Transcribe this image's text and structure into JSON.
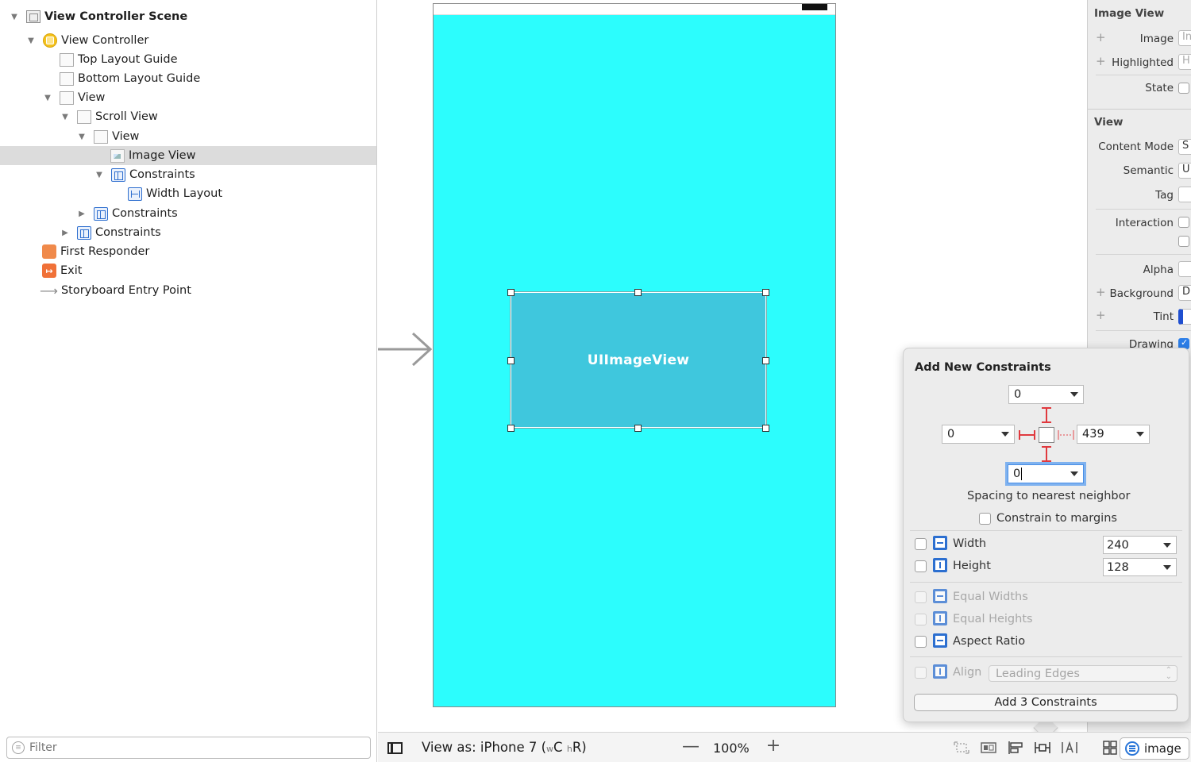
{
  "outline": {
    "items": [
      {
        "label": "View Controller Scene",
        "expanded": true,
        "icon": "scene-icon"
      },
      {
        "label": "View Controller",
        "expanded": true,
        "icon": "view-controller-icon"
      },
      {
        "label": "Top Layout Guide",
        "icon": "layout-guide-icon"
      },
      {
        "label": "Bottom Layout Guide",
        "icon": "layout-guide-icon"
      },
      {
        "label": "View",
        "expanded": true,
        "icon": "view-icon"
      },
      {
        "label": "Scroll View",
        "expanded": true,
        "icon": "scroll-view-icon"
      },
      {
        "label": "View",
        "expanded": true,
        "icon": "view-icon"
      },
      {
        "label": "Image View",
        "selected": true,
        "icon": "image-view-icon"
      },
      {
        "label": "Constraints",
        "expanded": true,
        "icon": "constraints-icon"
      },
      {
        "label": "Width Layout",
        "icon": "width-constraint-icon"
      },
      {
        "label": "Constraints",
        "expanded": false,
        "icon": "constraints-icon"
      },
      {
        "label": "Constraints",
        "expanded": false,
        "icon": "constraints-icon"
      },
      {
        "label": "First Responder",
        "icon": "first-responder-icon"
      },
      {
        "label": "Exit",
        "icon": "exit-icon"
      },
      {
        "label": "Storyboard Entry Point",
        "icon": "entry-arrow-icon"
      }
    ],
    "filter_placeholder": "Filter"
  },
  "canvas": {
    "image_view_label": "UIImageView",
    "phone_background": "#2cfdfd",
    "image_view_color": "#3fc7dd"
  },
  "bottombar": {
    "view_as": "View as: iPhone 7 (",
    "size_class_w": "w",
    "size_class_c": "C",
    "size_class_h": "h",
    "size_class_r": "R",
    "zoom_out": "—",
    "zoom_level": "100%",
    "zoom_in": "+",
    "image_pill": "image"
  },
  "inspector": {
    "image_view_title": "Image View",
    "image_label": "Image",
    "image_value": "In",
    "highlighted_label": "Highlighted",
    "highlighted_value": "H",
    "state_label": "State",
    "view_title": "View",
    "content_mode_label": "Content Mode",
    "content_mode_value": "S",
    "semantic_label": "Semantic",
    "semantic_value": "U",
    "tag_label": "Tag",
    "interaction_label": "Interaction",
    "alpha_label": "Alpha",
    "background_label": "Background",
    "background_value": "D",
    "tint_label": "Tint",
    "drawing_label": "Drawing",
    "plus": "+"
  },
  "constraints_popover": {
    "title": "Add New Constraints",
    "top_value": "0",
    "leading_value": "0",
    "trailing_value": "439",
    "bottom_value": "0",
    "spacing_label": "Spacing to nearest neighbor",
    "margins_label": "Constrain to margins",
    "width_label": "Width",
    "width_value": "240",
    "height_label": "Height",
    "height_value": "128",
    "equal_widths_label": "Equal Widths",
    "equal_heights_label": "Equal Heights",
    "aspect_ratio_label": "Aspect Ratio",
    "align_label": "Align",
    "align_value": "Leading Edges",
    "add_button_label": "Add 3 Constraints",
    "accent": "#2c6fd0",
    "strut_color": "#e0393e"
  }
}
